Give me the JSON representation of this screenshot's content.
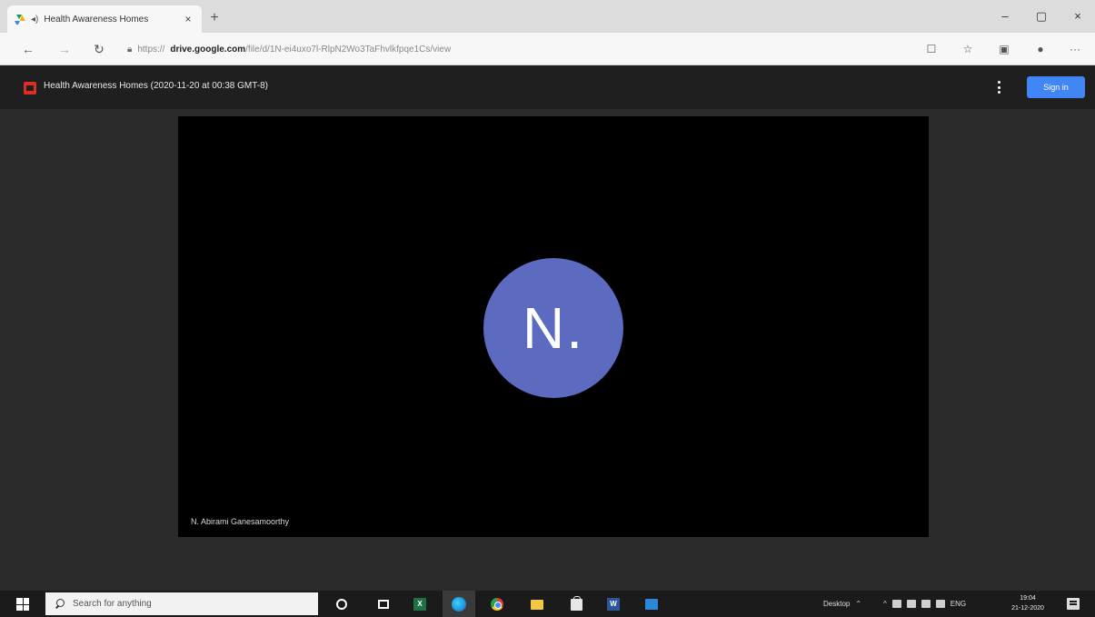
{
  "browser": {
    "tab_title": "Health Awareness Homes",
    "tab_close": "×",
    "new_tab": "+",
    "url_scheme": "https://",
    "url_host": "drive.google.com",
    "url_path": "/file/d/1N-ei4uxo7l-RlpN2Wo3TaFhvlkfpqe1Cs/view",
    "window": {
      "minimize": "–",
      "maximize": "▢",
      "close": "×"
    }
  },
  "viewer": {
    "file_title": "Health Awareness Homes (2020-11-20 at 00:38 GMT-8)",
    "sign_in": "Sign in"
  },
  "video": {
    "avatar_initial": "N.",
    "avatar_color": "#5c6bc0",
    "participant_name": "N. Abirami Ganesamoorthy"
  },
  "taskbar": {
    "search_placeholder": "Search for anything",
    "tray_label": "Desktop",
    "tray_lang": "ENG",
    "clock_time": "19:04",
    "clock_date": "21-12-2020"
  },
  "colors": {
    "accent": "#4285f4",
    "drive_file": "#d93025"
  }
}
